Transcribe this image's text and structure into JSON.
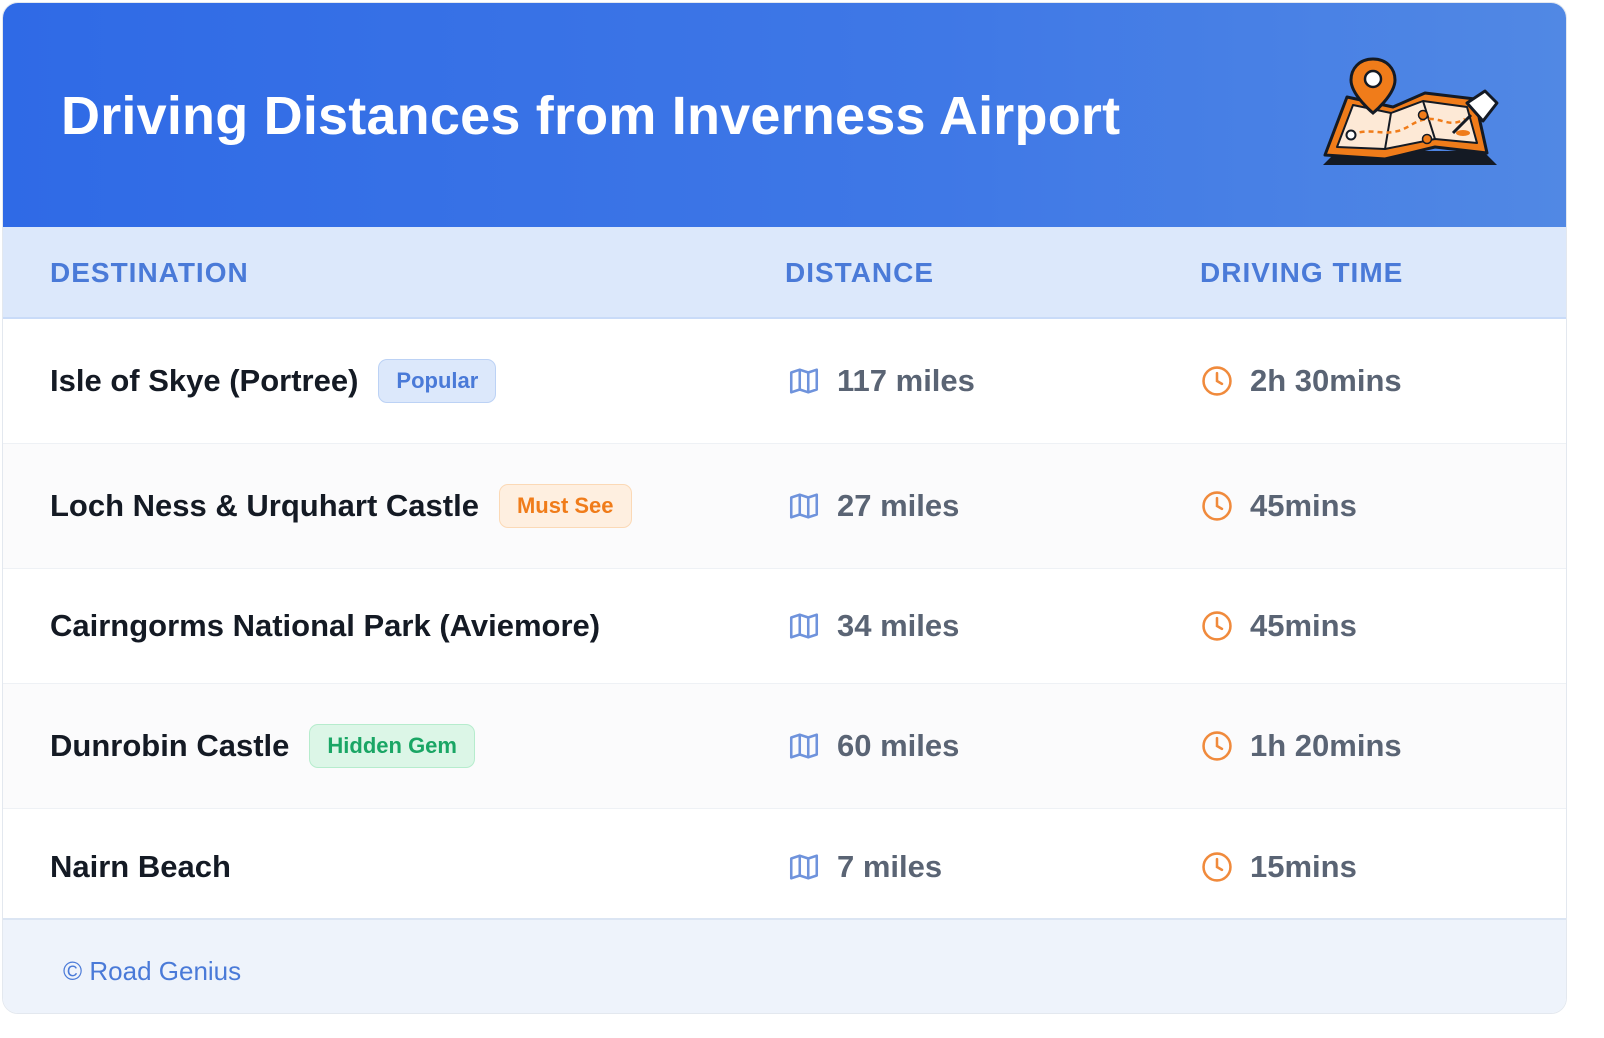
{
  "header": {
    "title": "Driving Distances from Inverness Airport",
    "illustration_icon": "folded-map-with-pins-icon"
  },
  "columns": {
    "destination": "DESTINATION",
    "distance": "DISTANCE",
    "driving_time": "DRIVING TIME"
  },
  "rows": [
    {
      "name": "Isle of Skye (Portree)",
      "badge": "Popular",
      "badge_color": "#4a7ad8",
      "distance": "117 miles",
      "time": "2h 30mins"
    },
    {
      "name": "Loch Ness & Urquhart Castle",
      "badge": "Must See",
      "badge_color": "#f07c1a",
      "distance": "27 miles",
      "time": "45mins"
    },
    {
      "name": "Cairngorms National Park (Aviemore)",
      "badge": "",
      "distance": "34 miles",
      "time": "45mins"
    },
    {
      "name": "Dunrobin Castle",
      "badge": "Hidden Gem",
      "badge_color": "#1aa665",
      "distance": "60 miles",
      "time": "1h 20mins"
    },
    {
      "name": "Nairn Beach",
      "badge": "",
      "distance": "7 miles",
      "time": "15mins"
    }
  ],
  "icons": {
    "distance": "map-icon",
    "time": "clock-icon"
  },
  "footer": {
    "credit": "© Road Genius"
  },
  "colors": {
    "header_start": "#2f6ae6",
    "header_end": "#5188e4",
    "accent_blue": "#4a7ad8",
    "clock_orange": "#f08a3c"
  }
}
